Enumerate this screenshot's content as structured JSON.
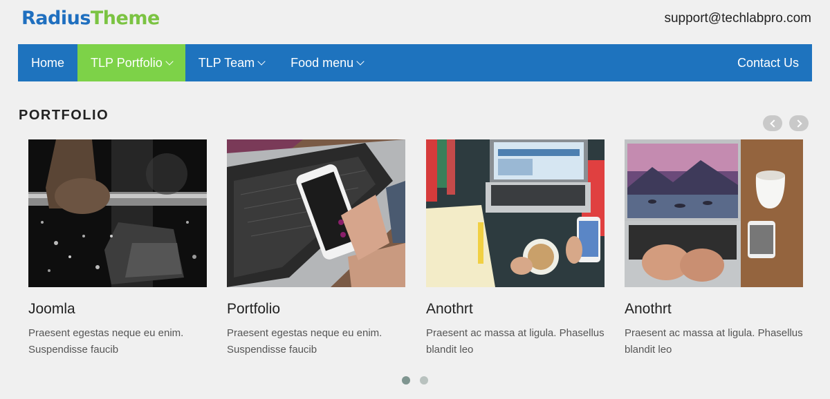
{
  "header": {
    "logo_part1": "Radius",
    "logo_part2": "Theme",
    "support_email": "support@techlabpro.com"
  },
  "nav": {
    "items": [
      {
        "label": "Home",
        "dropdown": false,
        "active": false
      },
      {
        "label": "TLP Portfolio",
        "dropdown": true,
        "active": true
      },
      {
        "label": "TLP Team",
        "dropdown": true,
        "active": false
      },
      {
        "label": "Food menu",
        "dropdown": true,
        "active": false
      }
    ],
    "contact_label": "Contact Us",
    "colors": {
      "bar": "#1e73be",
      "active": "#7dd248"
    }
  },
  "portfolio": {
    "heading": "PORTFOLIO",
    "prev_icon": "chevron-left-icon",
    "next_icon": "chevron-right-icon",
    "cards": [
      {
        "title": "Joomla",
        "description": "Praesent egestas neque eu enim. Suspendisse faucib",
        "image": "weightlifter-photo"
      },
      {
        "title": "Portfolio",
        "description": "Praesent egestas neque eu enim. Suspendisse faucib",
        "image": "phone-laptop-photo"
      },
      {
        "title": "Anothrt",
        "description": "Praesent ac massa at ligula. Phasellus blandit leo",
        "image": "desk-laptop-coffee-photo"
      },
      {
        "title": "Anothrt",
        "description": "Praesent ac massa at ligula. Phasellus blandit leo",
        "image": "laptop-typing-photo"
      }
    ],
    "pagination": {
      "pages": 2,
      "current": 1
    }
  }
}
